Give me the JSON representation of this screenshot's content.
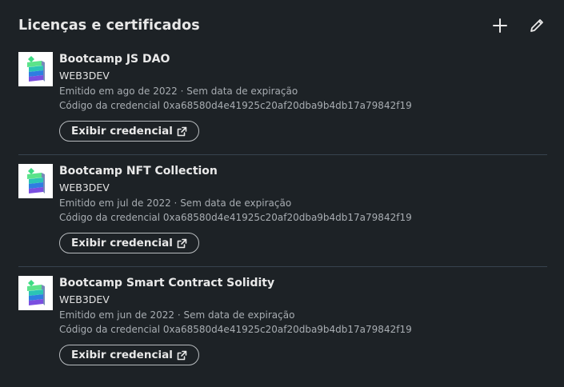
{
  "section": {
    "title": "Licenças e certificados",
    "add_icon": "plus-icon",
    "edit_icon": "pencil-icon"
  },
  "certificates": [
    {
      "name": "Bootcamp JS DAO",
      "issuer": "WEB3DEV",
      "issued": "Emitido em ago de 2022 · Sem data de expiração",
      "credential": "Código da credencial 0xa68580d4e41925c20af20dba9b4db17a79842f19",
      "button_label": "Exibir credencial",
      "button_icon": "external-link-icon"
    },
    {
      "name": "Bootcamp NFT Collection",
      "issuer": "WEB3DEV",
      "issued": "Emitido em jul de 2022 · Sem data de expiração",
      "credential": "Código da credencial 0xa68580d4e41925c20af20dba9b4db17a79842f19",
      "button_label": "Exibir credencial",
      "button_icon": "external-link-icon"
    },
    {
      "name": "Bootcamp Smart Contract Solidity",
      "issuer": "WEB3DEV",
      "issued": "Emitido em jun de 2022 · Sem data de expiração",
      "credential": "Código da credencial 0xa68580d4e41925c20af20dba9b4db17a79842f19",
      "button_label": "Exibir credencial",
      "button_icon": "external-link-icon"
    }
  ],
  "colors": {
    "background": "#1d2226",
    "divider": "#38434f",
    "muted_text": "#a8adb2",
    "logo_green": "#3ddc84",
    "logo_blue": "#2f7de1",
    "logo_purple": "#7a4fe0"
  }
}
